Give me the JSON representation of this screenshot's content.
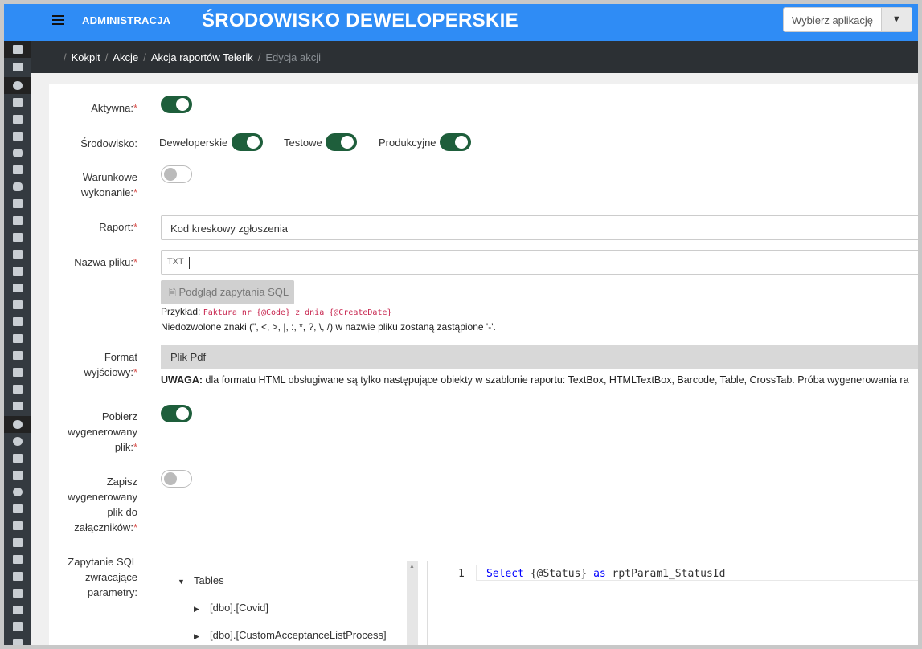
{
  "header": {
    "admin_label": "ADMINISTRACJA",
    "environment_title": "ŚRODOWISKO DEWELOPERSKIE",
    "app_select": {
      "placeholder": "Wybierz aplikację",
      "arrow": "▼"
    },
    "bg_color": "#2f8cf5"
  },
  "breadcrumb": {
    "items": [
      "Kokpit",
      "Akcje",
      "Akcja raportów Telerik"
    ],
    "current": "Edycja akcji",
    "separator": "/"
  },
  "form": {
    "required_mark": "*",
    "active": {
      "label": "Aktywna:",
      "on": true
    },
    "environment": {
      "label": "Środowisko:",
      "options": [
        {
          "label": "Deweloperskie",
          "on": true
        },
        {
          "label": "Testowe",
          "on": true
        },
        {
          "label": "Produkcyjne",
          "on": true
        }
      ]
    },
    "conditional": {
      "label_1": "Warunkowe",
      "label_2": "wykonanie:",
      "on": false
    },
    "report": {
      "label": "Raport:",
      "value": "Kod kreskowy zgłoszenia"
    },
    "file_name": {
      "label": "Nazwa pliku:",
      "addon": "TXT",
      "value": "",
      "preview_button": "Podgląd zapytania SQL",
      "example_label": "Przykład:",
      "example_code": "Faktura nr {@Code} z dnia {@CreateDate}",
      "note": "Niedozwolone znaki (\", <, >, |, :, *, ?, \\, /) w nazwie pliku zostaną zastąpione '-'."
    },
    "output_format": {
      "label_1": "Format",
      "label_2": "wyjściowy:",
      "value": "Plik Pdf",
      "warning_bold": "UWAGA:",
      "warning_text": " dla formatu HTML obsługiwane są tylko następujące obiekty w szablonie raportu: TextBox, HTMLTextBox, Barcode, Table, CrossTab. Próba wygenerowania ra"
    },
    "download": {
      "label_1": "Pobierz",
      "label_2": "wygenerowany",
      "label_3": "plik:",
      "on": true
    },
    "save_attachment": {
      "label_1": "Zapisz",
      "label_2": "wygenerowany",
      "label_3": "plik do",
      "label_4": "załączników:",
      "on": false
    },
    "sql_query": {
      "label_1": "Zapytanie SQL",
      "label_2": "zwracające",
      "label_3": "parametry:",
      "tree": {
        "root": "Tables",
        "items": [
          "[dbo].[Covid]",
          "[dbo].[CustomAcceptanceListProcess]"
        ]
      },
      "editor": {
        "line_number": "1",
        "kw_select": "Select",
        "param": " {@Status} ",
        "kw_as": "as",
        "alias": " rptParam1_StatusId"
      }
    }
  },
  "colors": {
    "toggle_on": "#1e5e3b",
    "sidebar": "#343a40",
    "breadcrumb_bar": "#2c3034",
    "required": "#d9534f"
  }
}
